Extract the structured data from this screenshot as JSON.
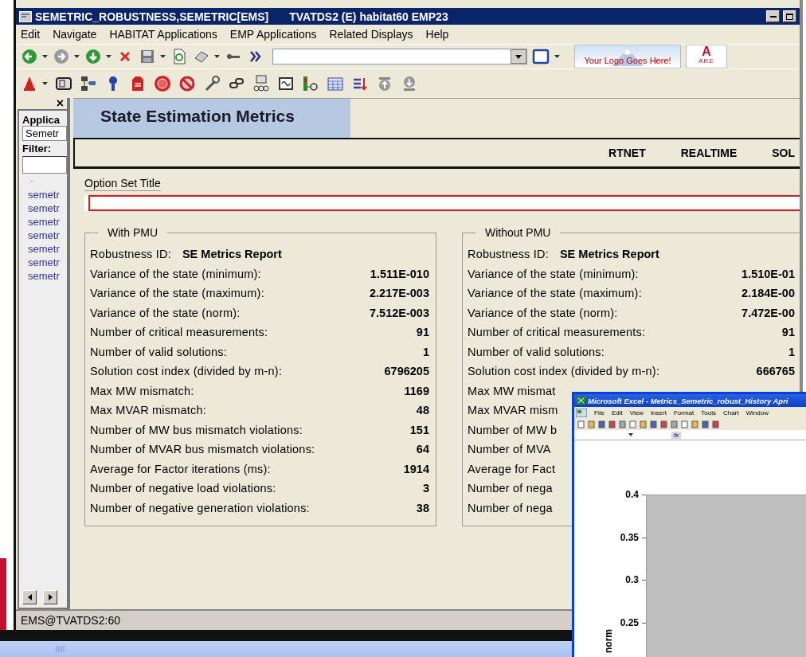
{
  "window": {
    "title": "SEMETRIC_ROBUSTNESS,SEMETRIC[EMS]",
    "subtitle": "TVATDS2 (E) habitat60 EMP23"
  },
  "menu": [
    "Edit",
    "Navigate",
    "HABITAT Applications",
    "EMP Applications",
    "Related Displays",
    "Help"
  ],
  "toolbar": {
    "logo_text": "Your Logo Goes Here!",
    "logo2_mark": "A",
    "logo2_text": "ARE"
  },
  "sidebar": {
    "close": "×",
    "label": "Applica",
    "dropdown": "Semetr",
    "filter_label": "Filter:",
    "dash": "-",
    "items": [
      "semetr",
      "semetr",
      "semetr",
      "semetr",
      "semetr",
      "semetr",
      "semetr"
    ]
  },
  "main": {
    "title": "State Estimation Metrics",
    "columns": [
      "RTNET",
      "REALTIME",
      "SOL"
    ],
    "option_label": "Option Set Title",
    "groups": [
      {
        "title": "With PMU",
        "id_label": "Robustness ID:",
        "id_value": "SE Metrics Report",
        "rows": [
          {
            "label": "Variance of the state (minimum):",
            "value": "1.511E-010"
          },
          {
            "label": "Variance of the state (maximum):",
            "value": "2.217E-003"
          },
          {
            "label": "Variance of the state (norm):",
            "value": "7.512E-003"
          },
          {
            "label": "Number of critical measurements:",
            "value": "91"
          },
          {
            "label": "Number of valid solutions:",
            "value": "1"
          },
          {
            "label": "Solution cost index (divided by m-n):",
            "value": "6796205"
          },
          {
            "label": "Max MW mismatch:",
            "value": "1169"
          },
          {
            "label": "Max MVAR mismatch:",
            "value": "48"
          },
          {
            "label": "Number of MW bus mismatch violations:",
            "value": "151"
          },
          {
            "label": "Number of MVAR bus mismatch violations:",
            "value": "64"
          },
          {
            "label": "Average for Factor iterations (ms):",
            "value": "1914"
          },
          {
            "label": "Number of negative load violations:",
            "value": "3"
          },
          {
            "label": "Number of negative generation violations:",
            "value": "38"
          }
        ]
      },
      {
        "title": "Without PMU",
        "id_label": "Robustness ID:",
        "id_value": "SE Metrics Report",
        "rows": [
          {
            "label": "Variance of the state (minimum):",
            "value": "1.510E-01"
          },
          {
            "label": "Variance of the state (maximum):",
            "value": "2.184E-00"
          },
          {
            "label": "Variance of the state (norm):",
            "value": "7.472E-00"
          },
          {
            "label": "Number of critical measurements:",
            "value": "91"
          },
          {
            "label": "Number of valid solutions:",
            "value": "1"
          },
          {
            "label": "Solution cost index (divided by m-n):",
            "value": "666765"
          },
          {
            "label": "Max MW mismat"
          },
          {
            "label": "Max MVAR mism"
          },
          {
            "label": "Number of MW b"
          },
          {
            "label": "Number of MVA"
          },
          {
            "label": "Average for Fact"
          },
          {
            "label": "Number of nega"
          },
          {
            "label": "Number of nega"
          }
        ]
      }
    ]
  },
  "status_bar": "EMS@TVATDS2:60",
  "excel": {
    "title": "Microsoft Excel - Metrics_Semetric_robust_History Apri",
    "menu": [
      "File",
      "Edit",
      "View",
      "Insert",
      "Format",
      "Tools",
      "Chart",
      "Window"
    ],
    "fx": "fx",
    "y_ticks": [
      "0.4",
      "0.35",
      "0.3",
      "0.25"
    ],
    "ylabel": "norm"
  }
}
